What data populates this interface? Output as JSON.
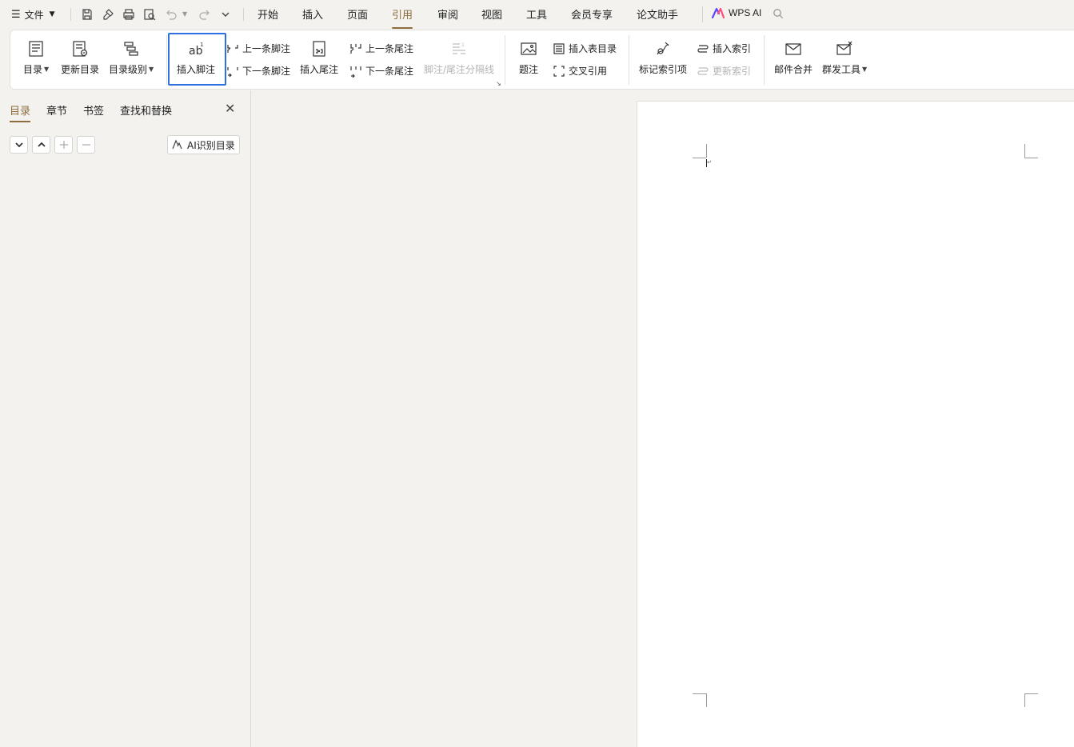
{
  "menubar": {
    "file_label": "文件",
    "tabs": [
      {
        "label": "开始"
      },
      {
        "label": "插入"
      },
      {
        "label": "页面"
      },
      {
        "label": "引用"
      },
      {
        "label": "审阅"
      },
      {
        "label": "视图"
      },
      {
        "label": "工具"
      },
      {
        "label": "会员专享"
      },
      {
        "label": "论文助手"
      }
    ],
    "active_tab": "引用",
    "wps_ai_label": "WPS AI"
  },
  "ribbon": {
    "toc": "目录",
    "update_toc": "更新目录",
    "toc_level": "目录级别",
    "insert_footnote": "插入脚注",
    "prev_footnote": "上一条脚注",
    "next_footnote": "下一条脚注",
    "insert_endnote": "插入尾注",
    "prev_endnote": "上一条尾注",
    "next_endnote": "下一条尾注",
    "separator": "脚注/尾注分隔线",
    "caption": "题注",
    "insert_table_of_figures": "插入表目录",
    "cross_reference": "交叉引用",
    "mark_index_entry": "标记索引项",
    "insert_index": "插入索引",
    "update_index": "更新索引",
    "mail_merge": "邮件合并",
    "mass_send": "群发工具"
  },
  "navpane": {
    "tabs": [
      {
        "label": "目录"
      },
      {
        "label": "章节"
      },
      {
        "label": "书签"
      },
      {
        "label": "查找和替换"
      }
    ],
    "active_tab": "目录",
    "ai_toc_label": "AI识别目录"
  },
  "colors": {
    "accent": "#8c6d3e",
    "highlight": "#2f6fe0",
    "background": "#f3f2ee"
  }
}
